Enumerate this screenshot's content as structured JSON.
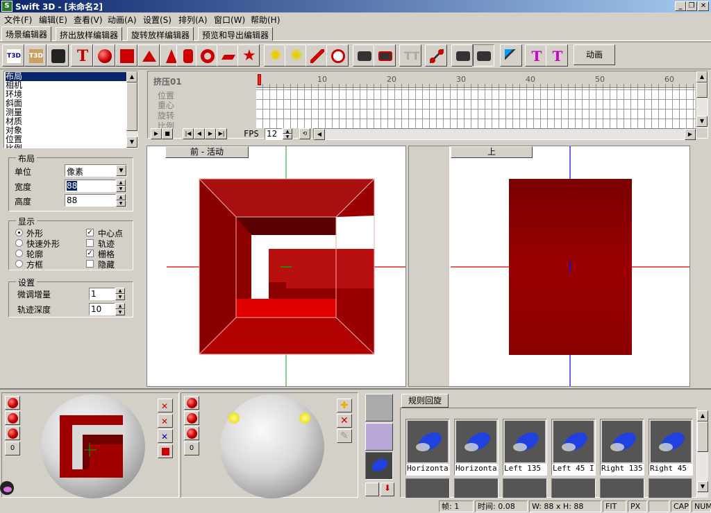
{
  "window": {
    "title": "Swift 3D - [未命名2]"
  },
  "menu": [
    "文件(F)",
    "编辑(E)",
    "查看(V)",
    "动画(A)",
    "设置(S)",
    "排列(A)",
    "窗口(W)",
    "帮助(H)"
  ],
  "tabs": [
    "场景编辑器",
    "挤出放样编辑器",
    "旋转放样编辑器",
    "预览和导出编辑器"
  ],
  "toolbar": {
    "animate_label": "动画"
  },
  "property_list": {
    "items": [
      "布局",
      "相机",
      "环境",
      "斜面",
      "测量",
      "材质",
      "对象",
      "位置",
      "比例"
    ],
    "selected_index": 0
  },
  "layout_group": {
    "title": "布局",
    "unit_label": "单位",
    "unit_value": "像素",
    "width_label": "宽度",
    "width_value": "88",
    "height_label": "高度",
    "height_value": "88"
  },
  "display_group": {
    "title": "显示",
    "radios": [
      {
        "label": "外形",
        "checked": true
      },
      {
        "label": "快速外形",
        "checked": false
      },
      {
        "label": "轮廓",
        "checked": false
      },
      {
        "label": "方框",
        "checked": false
      }
    ],
    "checks": [
      {
        "label": "中心点",
        "checked": true
      },
      {
        "label": "轨迹",
        "checked": false
      },
      {
        "label": "栅格",
        "checked": true
      },
      {
        "label": "隐藏",
        "checked": false
      }
    ]
  },
  "settings_group": {
    "title": "设置",
    "nudge_label": "微调增量",
    "nudge_value": "1",
    "trail_label": "轨迹深度",
    "trail_value": "10"
  },
  "timeline": {
    "object_name": "挤压01",
    "tracks": [
      "位置",
      "重心",
      "旋转",
      "比例"
    ],
    "ruler": [
      "10",
      "20",
      "30",
      "40",
      "50",
      "60"
    ],
    "fps_label": "FPS",
    "fps_value": "12"
  },
  "viewports": {
    "front_label": "前 - 活动",
    "top_label": "上"
  },
  "trackball_zero": "0",
  "gallery": {
    "tab": "规则回旋",
    "items": [
      "Horizontal",
      "Horizontal",
      "Left 135",
      "Left 45 I",
      "Right 135",
      "Right 45"
    ]
  },
  "status": {
    "frame": "帧: 1",
    "time": "时间: 0.08",
    "size": "W: 88 x H: 88",
    "fit": "FIT",
    "px": "PX",
    "cap": "CAP",
    "num": "NUM"
  },
  "colors": {
    "titlebar": "#0a246a",
    "extrude_red": "#9a0000",
    "selection": "#0a246a"
  }
}
